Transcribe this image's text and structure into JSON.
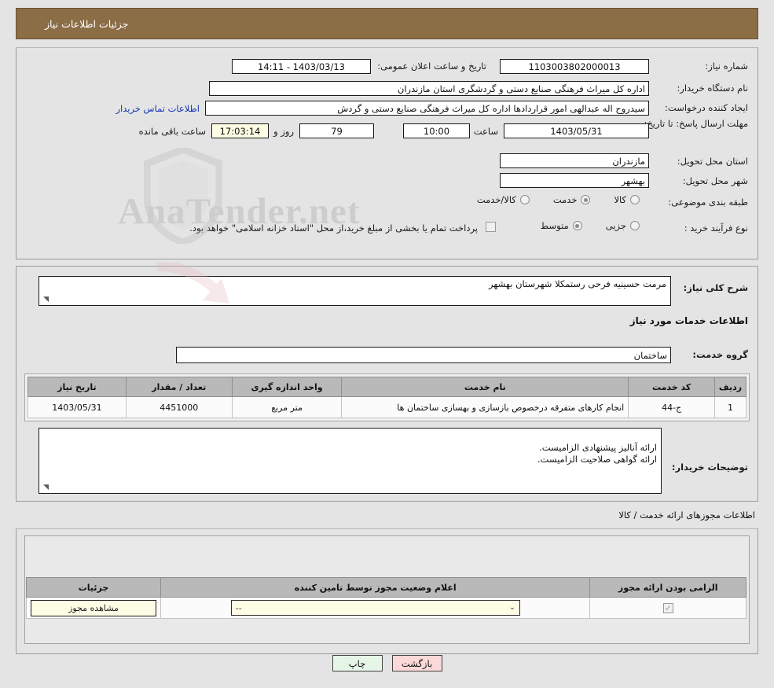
{
  "header": {
    "title": "جزئیات اطلاعات نیاز"
  },
  "watermark": {
    "text": "AnaTender.net"
  },
  "top": {
    "need_number_label": "شماره نیاز:",
    "need_number_value": "1103003802000013",
    "announce_label": "تاریخ و ساعت اعلان عمومی:",
    "announce_value": "1403/03/13 - 14:11",
    "buyer_org_label": "نام دستگاه خریدار:",
    "buyer_org_value": "اداره کل میراث فرهنگی  صنایع دستی و گردشگری استان مازندران",
    "creator_label": "ایجاد کننده درخواست:",
    "creator_value": "سیدروح اله عبدالهی امور قراردادها اداره کل میراث فرهنگی  صنایع دستی و گردش",
    "contact_link": "اطلاعات تماس خریدار",
    "deadline_label": "مهلت ارسال پاسخ: تا تاریخ:",
    "deadline_date": "1403/05/31",
    "time_label": "ساعت",
    "deadline_time": "10:00",
    "days_value": "79",
    "days_label": "روز و",
    "timer_value": "17:03:14",
    "remaining_label": "ساعت باقی مانده",
    "province_label": "استان محل تحویل:",
    "province_value": "مازندران",
    "city_label": "شهر محل تحویل:",
    "city_value": "بهشهر",
    "category_label": "طبقه بندی موضوعی:",
    "category_options": [
      {
        "label": "کالا",
        "selected": false
      },
      {
        "label": "خدمت",
        "selected": true
      },
      {
        "label": "کالا/خدمت",
        "selected": false
      }
    ],
    "process_label": "نوع فرآیند خرید :",
    "process_options": [
      {
        "label": "جزیی",
        "selected": false
      },
      {
        "label": "متوسط",
        "selected": true
      }
    ],
    "treasury_checked": false,
    "treasury_note": "پرداخت تمام یا بخشی از مبلغ خرید،از محل \"اسناد خزانه اسلامی\" خواهد بود."
  },
  "mid": {
    "overview_label": "شرح کلی نیاز:",
    "overview_value": "مرمت حسینیه فرحی رستمکلا شهرستان بهشهر",
    "services_heading": "اطلاعات خدمات مورد نیاز",
    "service_group_label": "گروه خدمت:",
    "service_group_value": "ساختمان",
    "table": {
      "columns": [
        "ردیف",
        "کد خدمت",
        "نام خدمت",
        "واحد اندازه گیری",
        "تعداد / مقدار",
        "تاریخ نیاز"
      ],
      "rows": [
        {
          "row": "1",
          "code": "ج-44",
          "name": "انجام کارهای متفرقه درخصوص بازسازی و بهسازی ساختمان ها",
          "unit": "متر مربع",
          "qty": "4451000",
          "date": "1403/05/31"
        }
      ]
    },
    "notes_label": "توضیحات خریدار:",
    "notes_value": "ارائه آنالیز پیشنهادی الزامیست.\nارائه گواهی صلاحیت الزامیست."
  },
  "permits": {
    "heading": "اطلاعات مجوزهای ارائه خدمت / کالا",
    "columns": [
      "الزامی بودن ارائه مجوز",
      "اعلام وضعیت مجوز توسط تامین کننده",
      "جزئیات"
    ],
    "rows": [
      {
        "required_checked": true,
        "status_value": "--",
        "details_button": "مشاهده مجوز"
      }
    ]
  },
  "footer": {
    "print_label": "چاپ",
    "back_label": "بازگشت"
  },
  "colors": {
    "header_bar": "#8b6d46",
    "page_bg": "#e4e4e4",
    "link": "#1436b4",
    "table_header": "#b9b9b9",
    "cream_field": "#fdfce4",
    "btn_print": "#e6f6e6",
    "btn_back": "#fbd9d9"
  }
}
